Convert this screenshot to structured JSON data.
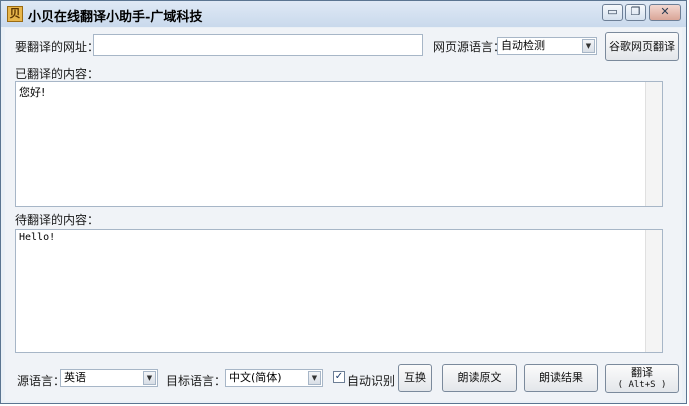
{
  "window": {
    "title": "小贝在线翻译小助手-广域科技",
    "icon_glyph": "贝",
    "minimize_glyph": "▭",
    "restore_glyph": "❐",
    "close_glyph": "✕"
  },
  "url_row": {
    "url_label": "要翻译的网址：",
    "url_value": "",
    "source_lang_label": "网页源语言：",
    "source_lang_value": "自动检测",
    "google_translate_button": "谷歌网页翻译"
  },
  "translated": {
    "label": "已翻译的内容：",
    "text": "您好!"
  },
  "pending": {
    "label": "待翻译的内容：",
    "text": "Hello!"
  },
  "bottom_bar": {
    "source_lang_label": "源语言：",
    "source_lang_value": "英语",
    "target_lang_label": "目标语言：",
    "target_lang_value": "中文(简体)",
    "auto_detect_label": "自动识别",
    "auto_detect_checked": true,
    "swap_button": "互换",
    "read_original_button": "朗读原文",
    "read_result_button": "朗读结果",
    "translate_button_line1": "翻译",
    "translate_button_line2": "( Alt+S )"
  },
  "icons": {
    "dropdown_arrow": "▼",
    "checkmark": "✓"
  }
}
